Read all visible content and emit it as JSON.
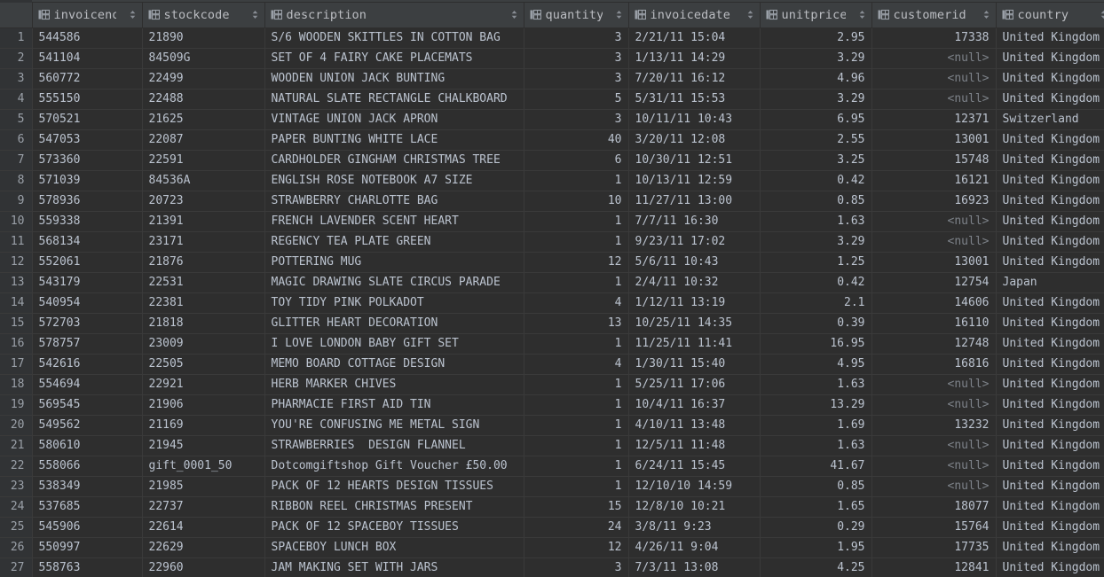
{
  "grid": {
    "row_number_header": "",
    "columns": [
      {
        "key": "invoiceno",
        "label": "invoiceno",
        "align": "left",
        "icon": "table-column-icon",
        "sort_icon": "sort-updown-icon"
      },
      {
        "key": "stockcode",
        "label": "stockcode",
        "align": "left",
        "icon": "table-column-icon",
        "sort_icon": "sort-updown-icon"
      },
      {
        "key": "description",
        "label": "description",
        "align": "left",
        "icon": "table-column-icon",
        "sort_icon": "sort-updown-icon"
      },
      {
        "key": "quantity",
        "label": "quantity",
        "align": "right",
        "icon": "table-column-icon",
        "sort_icon": "sort-updown-icon"
      },
      {
        "key": "invoicedate",
        "label": "invoicedate",
        "align": "left",
        "icon": "table-column-icon",
        "sort_icon": "sort-updown-icon"
      },
      {
        "key": "unitprice",
        "label": "unitprice",
        "align": "right",
        "icon": "table-column-icon",
        "sort_icon": "sort-updown-icon"
      },
      {
        "key": "customerid",
        "label": "customerid",
        "align": "right",
        "icon": "table-column-icon",
        "sort_icon": "sort-updown-icon"
      },
      {
        "key": "country",
        "label": "country",
        "align": "left",
        "icon": "table-column-icon",
        "sort_icon": "sort-updown-icon"
      }
    ],
    "null_text": "<null>",
    "rows": [
      {
        "n": "1",
        "invoiceno": "544586",
        "stockcode": "21890",
        "description": "S/6 WOODEN SKITTLES IN COTTON BAG",
        "quantity": "3",
        "invoicedate": "2/21/11 15:04",
        "unitprice": "2.95",
        "customerid": "17338",
        "country": "United Kingdom"
      },
      {
        "n": "2",
        "invoiceno": "541104",
        "stockcode": "84509G",
        "description": "SET OF 4 FAIRY CAKE PLACEMATS",
        "quantity": "3",
        "invoicedate": "1/13/11 14:29",
        "unitprice": "3.29",
        "customerid": "<null>",
        "country": "United Kingdom"
      },
      {
        "n": "3",
        "invoiceno": "560772",
        "stockcode": "22499",
        "description": "WOODEN UNION JACK BUNTING",
        "quantity": "3",
        "invoicedate": "7/20/11 16:12",
        "unitprice": "4.96",
        "customerid": "<null>",
        "country": "United Kingdom"
      },
      {
        "n": "4",
        "invoiceno": "555150",
        "stockcode": "22488",
        "description": "NATURAL SLATE RECTANGLE CHALKBOARD",
        "quantity": "5",
        "invoicedate": "5/31/11 15:53",
        "unitprice": "3.29",
        "customerid": "<null>",
        "country": "United Kingdom"
      },
      {
        "n": "5",
        "invoiceno": "570521",
        "stockcode": "21625",
        "description": "VINTAGE UNION JACK APRON",
        "quantity": "3",
        "invoicedate": "10/11/11 10:43",
        "unitprice": "6.95",
        "customerid": "12371",
        "country": "Switzerland"
      },
      {
        "n": "6",
        "invoiceno": "547053",
        "stockcode": "22087",
        "description": "PAPER BUNTING WHITE LACE",
        "quantity": "40",
        "invoicedate": "3/20/11 12:08",
        "unitprice": "2.55",
        "customerid": "13001",
        "country": "United Kingdom"
      },
      {
        "n": "7",
        "invoiceno": "573360",
        "stockcode": "22591",
        "description": "CARDHOLDER GINGHAM CHRISTMAS TREE",
        "quantity": "6",
        "invoicedate": "10/30/11 12:51",
        "unitprice": "3.25",
        "customerid": "15748",
        "country": "United Kingdom"
      },
      {
        "n": "8",
        "invoiceno": "571039",
        "stockcode": "84536A",
        "description": "ENGLISH ROSE NOTEBOOK A7 SIZE",
        "quantity": "1",
        "invoicedate": "10/13/11 12:59",
        "unitprice": "0.42",
        "customerid": "16121",
        "country": "United Kingdom"
      },
      {
        "n": "9",
        "invoiceno": "578936",
        "stockcode": "20723",
        "description": "STRAWBERRY CHARLOTTE BAG",
        "quantity": "10",
        "invoicedate": "11/27/11 13:00",
        "unitprice": "0.85",
        "customerid": "16923",
        "country": "United Kingdom"
      },
      {
        "n": "10",
        "invoiceno": "559338",
        "stockcode": "21391",
        "description": "FRENCH LAVENDER SCENT HEART",
        "quantity": "1",
        "invoicedate": "7/7/11 16:30",
        "unitprice": "1.63",
        "customerid": "<null>",
        "country": "United Kingdom"
      },
      {
        "n": "11",
        "invoiceno": "568134",
        "stockcode": "23171",
        "description": "REGENCY TEA PLATE GREEN",
        "quantity": "1",
        "invoicedate": "9/23/11 17:02",
        "unitprice": "3.29",
        "customerid": "<null>",
        "country": "United Kingdom"
      },
      {
        "n": "12",
        "invoiceno": "552061",
        "stockcode": "21876",
        "description": "POTTERING MUG",
        "quantity": "12",
        "invoicedate": "5/6/11 10:43",
        "unitprice": "1.25",
        "customerid": "13001",
        "country": "United Kingdom"
      },
      {
        "n": "13",
        "invoiceno": "543179",
        "stockcode": "22531",
        "description": "MAGIC DRAWING SLATE CIRCUS PARADE",
        "quantity": "1",
        "invoicedate": "2/4/11 10:32",
        "unitprice": "0.42",
        "customerid": "12754",
        "country": "Japan"
      },
      {
        "n": "14",
        "invoiceno": "540954",
        "stockcode": "22381",
        "description": "TOY TIDY PINK POLKADOT",
        "quantity": "4",
        "invoicedate": "1/12/11 13:19",
        "unitprice": "2.1",
        "customerid": "14606",
        "country": "United Kingdom"
      },
      {
        "n": "15",
        "invoiceno": "572703",
        "stockcode": "21818",
        "description": "GLITTER HEART DECORATION",
        "quantity": "13",
        "invoicedate": "10/25/11 14:35",
        "unitprice": "0.39",
        "customerid": "16110",
        "country": "United Kingdom"
      },
      {
        "n": "16",
        "invoiceno": "578757",
        "stockcode": "23009",
        "description": "I LOVE LONDON BABY GIFT SET",
        "quantity": "1",
        "invoicedate": "11/25/11 11:41",
        "unitprice": "16.95",
        "customerid": "12748",
        "country": "United Kingdom"
      },
      {
        "n": "17",
        "invoiceno": "542616",
        "stockcode": "22505",
        "description": "MEMO BOARD COTTAGE DESIGN",
        "quantity": "4",
        "invoicedate": "1/30/11 15:40",
        "unitprice": "4.95",
        "customerid": "16816",
        "country": "United Kingdom"
      },
      {
        "n": "18",
        "invoiceno": "554694",
        "stockcode": "22921",
        "description": "HERB MARKER CHIVES",
        "quantity": "1",
        "invoicedate": "5/25/11 17:06",
        "unitprice": "1.63",
        "customerid": "<null>",
        "country": "United Kingdom"
      },
      {
        "n": "19",
        "invoiceno": "569545",
        "stockcode": "21906",
        "description": "PHARMACIE FIRST AID TIN",
        "quantity": "1",
        "invoicedate": "10/4/11 16:37",
        "unitprice": "13.29",
        "customerid": "<null>",
        "country": "United Kingdom"
      },
      {
        "n": "20",
        "invoiceno": "549562",
        "stockcode": "21169",
        "description": "YOU'RE CONFUSING ME METAL SIGN",
        "quantity": "1",
        "invoicedate": "4/10/11 13:48",
        "unitprice": "1.69",
        "customerid": "13232",
        "country": "United Kingdom"
      },
      {
        "n": "21",
        "invoiceno": "580610",
        "stockcode": "21945",
        "description": "STRAWBERRIES  DESIGN FLANNEL",
        "quantity": "1",
        "invoicedate": "12/5/11 11:48",
        "unitprice": "1.63",
        "customerid": "<null>",
        "country": "United Kingdom"
      },
      {
        "n": "22",
        "invoiceno": "558066",
        "stockcode": "gift_0001_50",
        "description": "Dotcomgiftshop Gift Voucher £50.00",
        "quantity": "1",
        "invoicedate": "6/24/11 15:45",
        "unitprice": "41.67",
        "customerid": "<null>",
        "country": "United Kingdom"
      },
      {
        "n": "23",
        "invoiceno": "538349",
        "stockcode": "21985",
        "description": "PACK OF 12 HEARTS DESIGN TISSUES",
        "quantity": "1",
        "invoicedate": "12/10/10 14:59",
        "unitprice": "0.85",
        "customerid": "<null>",
        "country": "United Kingdom"
      },
      {
        "n": "24",
        "invoiceno": "537685",
        "stockcode": "22737",
        "description": "RIBBON REEL CHRISTMAS PRESENT",
        "quantity": "15",
        "invoicedate": "12/8/10 10:21",
        "unitprice": "1.65",
        "customerid": "18077",
        "country": "United Kingdom"
      },
      {
        "n": "25",
        "invoiceno": "545906",
        "stockcode": "22614",
        "description": "PACK OF 12 SPACEBOY TISSUES",
        "quantity": "24",
        "invoicedate": "3/8/11 9:23",
        "unitprice": "0.29",
        "customerid": "15764",
        "country": "United Kingdom"
      },
      {
        "n": "26",
        "invoiceno": "550997",
        "stockcode": "22629",
        "description": "SPACEBOY LUNCH BOX",
        "quantity": "12",
        "invoicedate": "4/26/11 9:04",
        "unitprice": "1.95",
        "customerid": "17735",
        "country": "United Kingdom"
      },
      {
        "n": "27",
        "invoiceno": "558763",
        "stockcode": "22960",
        "description": "JAM MAKING SET WITH JARS",
        "quantity": "3",
        "invoicedate": "7/3/11 13:08",
        "unitprice": "4.25",
        "customerid": "12841",
        "country": "United Kingdom"
      }
    ]
  },
  "colors": {
    "background": "#2e2e2e",
    "header_background": "#3c3f41",
    "gutter_background": "#313335",
    "text": "#bbc3cf",
    "header_text": "#bbbdc2",
    "null_text": "#7d8289",
    "grid_line": "#3a3a3a"
  }
}
